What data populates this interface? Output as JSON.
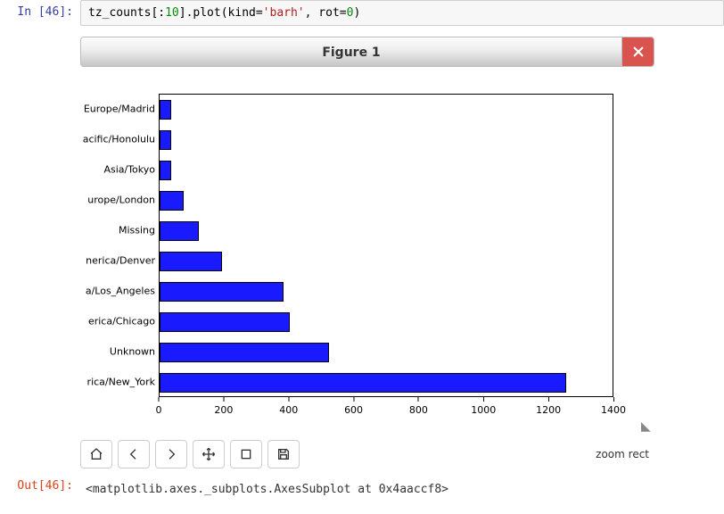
{
  "cell": {
    "in_prompt": "In [46]:",
    "out_prompt": "Out[46]:",
    "code_pre": "tz_counts[:",
    "code_num": "10",
    "code_mid": "].plot(kind=",
    "code_str": "'barh'",
    "code_post": ", rot=",
    "code_zero": "0",
    "code_end": ")"
  },
  "figure": {
    "title": "Figure 1"
  },
  "chart_data": {
    "type": "bar",
    "orientation": "horizontal",
    "categories": [
      "Europe/Madrid",
      "acific/Honolulu",
      "Asia/Tokyo",
      "urope/London",
      "Missing",
      "nerica/Denver",
      "a/Los_Angeles",
      "erica/Chicago",
      "Unknown",
      "rica/New_York"
    ],
    "values": [
      35,
      36,
      37,
      74,
      120,
      191,
      382,
      400,
      521,
      1251
    ],
    "xlim": [
      0,
      1400
    ],
    "xticks": [
      0,
      200,
      400,
      600,
      800,
      1000,
      1200,
      1400
    ],
    "title": "",
    "xlabel": "",
    "ylabel": ""
  },
  "toolbar": {
    "status": "zoom rect"
  },
  "output": {
    "repr": "<matplotlib.axes._subplots.AxesSubplot at 0x4aaccf8>"
  }
}
